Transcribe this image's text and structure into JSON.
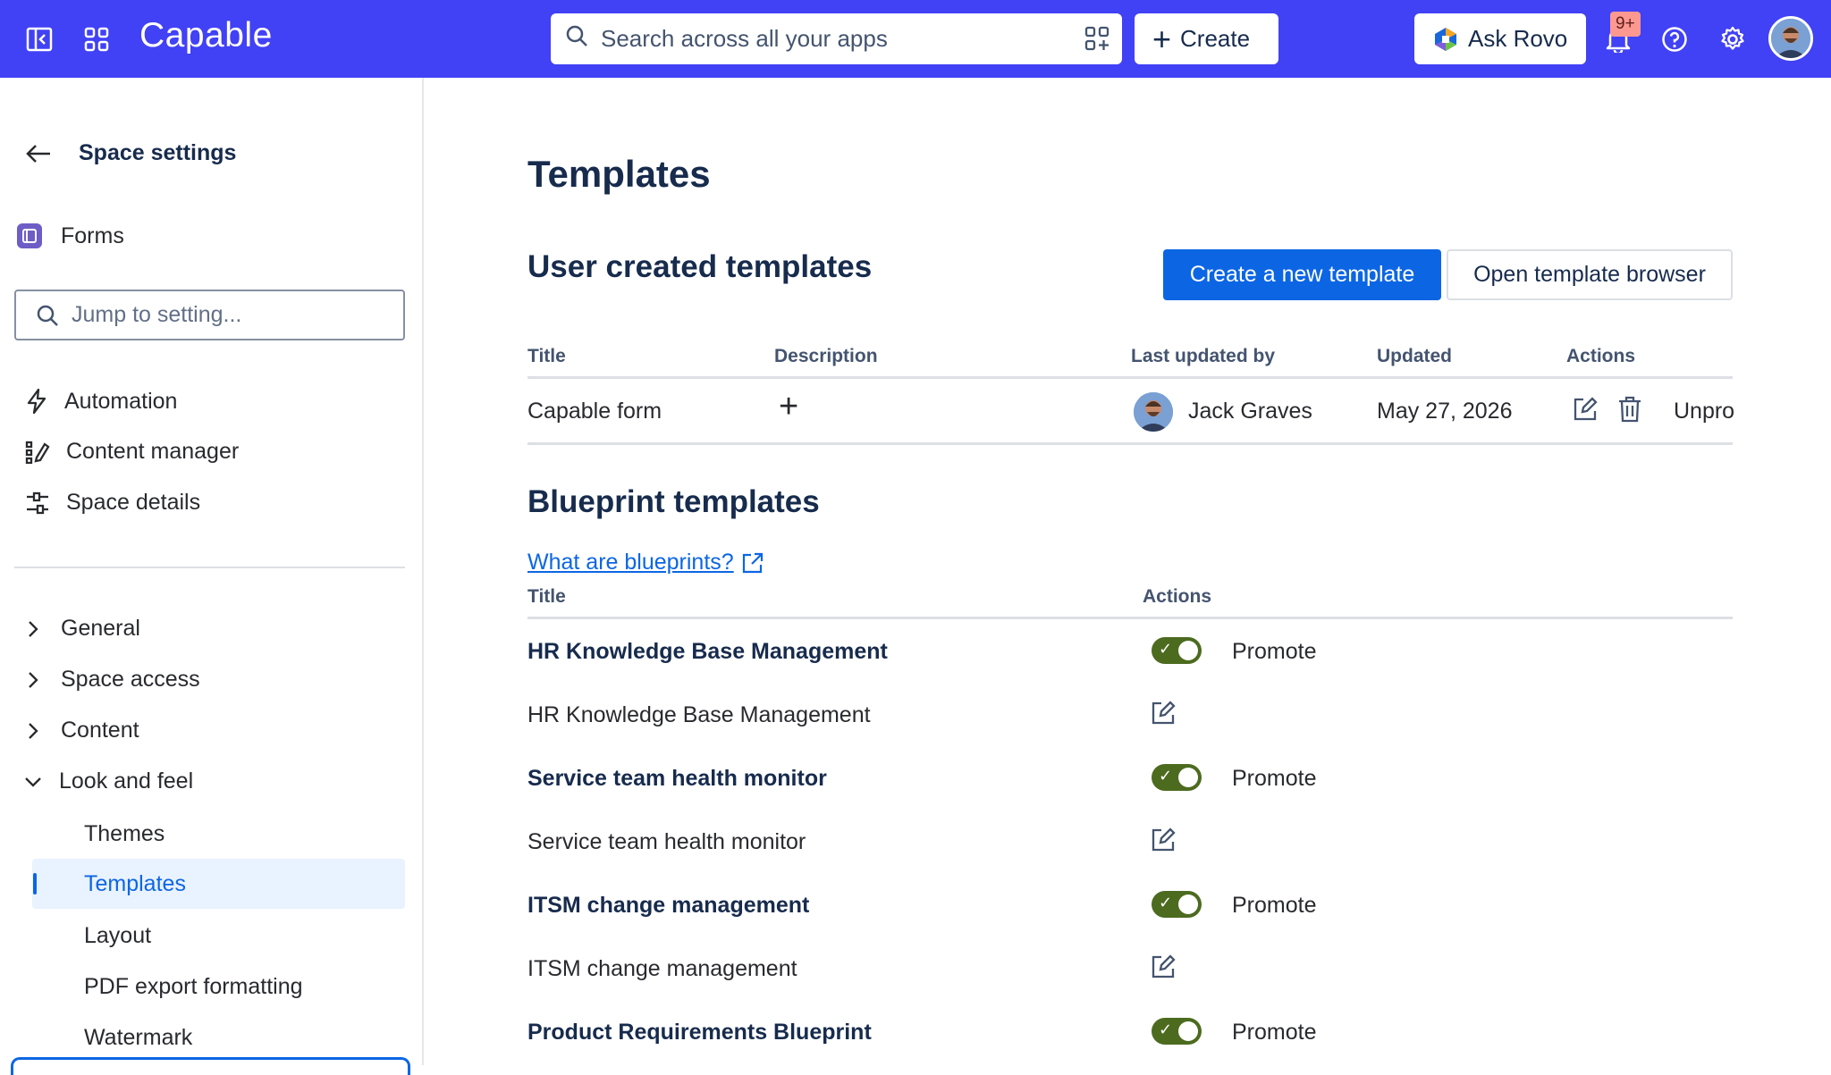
{
  "topbar": {
    "brand": "Capable",
    "search_placeholder": "Search across all your apps",
    "create_label": "Create",
    "ask_rovo_label": "Ask Rovo",
    "notifications_badge": "9+",
    "icons": [
      "sidebar-toggle-icon",
      "app-switcher-icon",
      "search-icon",
      "apps-filter-icon",
      "plus-icon",
      "rovo-logo-icon",
      "bell-icon",
      "help-icon",
      "gear-icon"
    ],
    "accent_color": "#4141f5"
  },
  "sidebar": {
    "back_label": "Space settings",
    "app_label": "Forms",
    "jump_placeholder": "Jump to setting...",
    "top_items": [
      {
        "label": "Automation",
        "icon": "lightning-icon"
      },
      {
        "label": "Content manager",
        "icon": "content-manager-icon"
      },
      {
        "label": "Space details",
        "icon": "sliders-icon"
      }
    ],
    "tree": [
      {
        "label": "General",
        "expanded": false
      },
      {
        "label": "Space access",
        "expanded": false
      },
      {
        "label": "Content",
        "expanded": false
      },
      {
        "label": "Look and feel",
        "expanded": true
      }
    ],
    "look_and_feel_items": [
      "Themes",
      "Templates",
      "Layout",
      "PDF export formatting",
      "Watermark"
    ],
    "selected": "Templates"
  },
  "main": {
    "title": "Templates",
    "user_section": {
      "title": "User created templates",
      "create_button": "Create a new template",
      "browser_button": "Open template browser",
      "columns": [
        "Title",
        "Description",
        "Last updated by",
        "Updated",
        "Actions"
      ],
      "rows": [
        {
          "title": "Capable form",
          "description": "+",
          "updated_by": "Jack Graves",
          "updated": "May 27, 2026",
          "action_text": "Unpro"
        }
      ]
    },
    "blueprint_section": {
      "title": "Blueprint templates",
      "link": "What are blueprints?",
      "columns": [
        "Title",
        "Actions"
      ],
      "rows": [
        {
          "title": "HR Knowledge Base Management",
          "bold": true,
          "action": "toggle",
          "action_label": "Promote"
        },
        {
          "title": "HR Knowledge Base Management",
          "bold": false,
          "action": "edit"
        },
        {
          "title": "Service team health monitor",
          "bold": true,
          "action": "toggle",
          "action_label": "Promote"
        },
        {
          "title": "Service team health monitor",
          "bold": false,
          "action": "edit"
        },
        {
          "title": "ITSM change management",
          "bold": true,
          "action": "toggle",
          "action_label": "Promote"
        },
        {
          "title": "ITSM change management",
          "bold": false,
          "action": "edit"
        },
        {
          "title": "Product Requirements Blueprint",
          "bold": true,
          "action": "toggle",
          "action_label": "Promote"
        }
      ]
    }
  }
}
